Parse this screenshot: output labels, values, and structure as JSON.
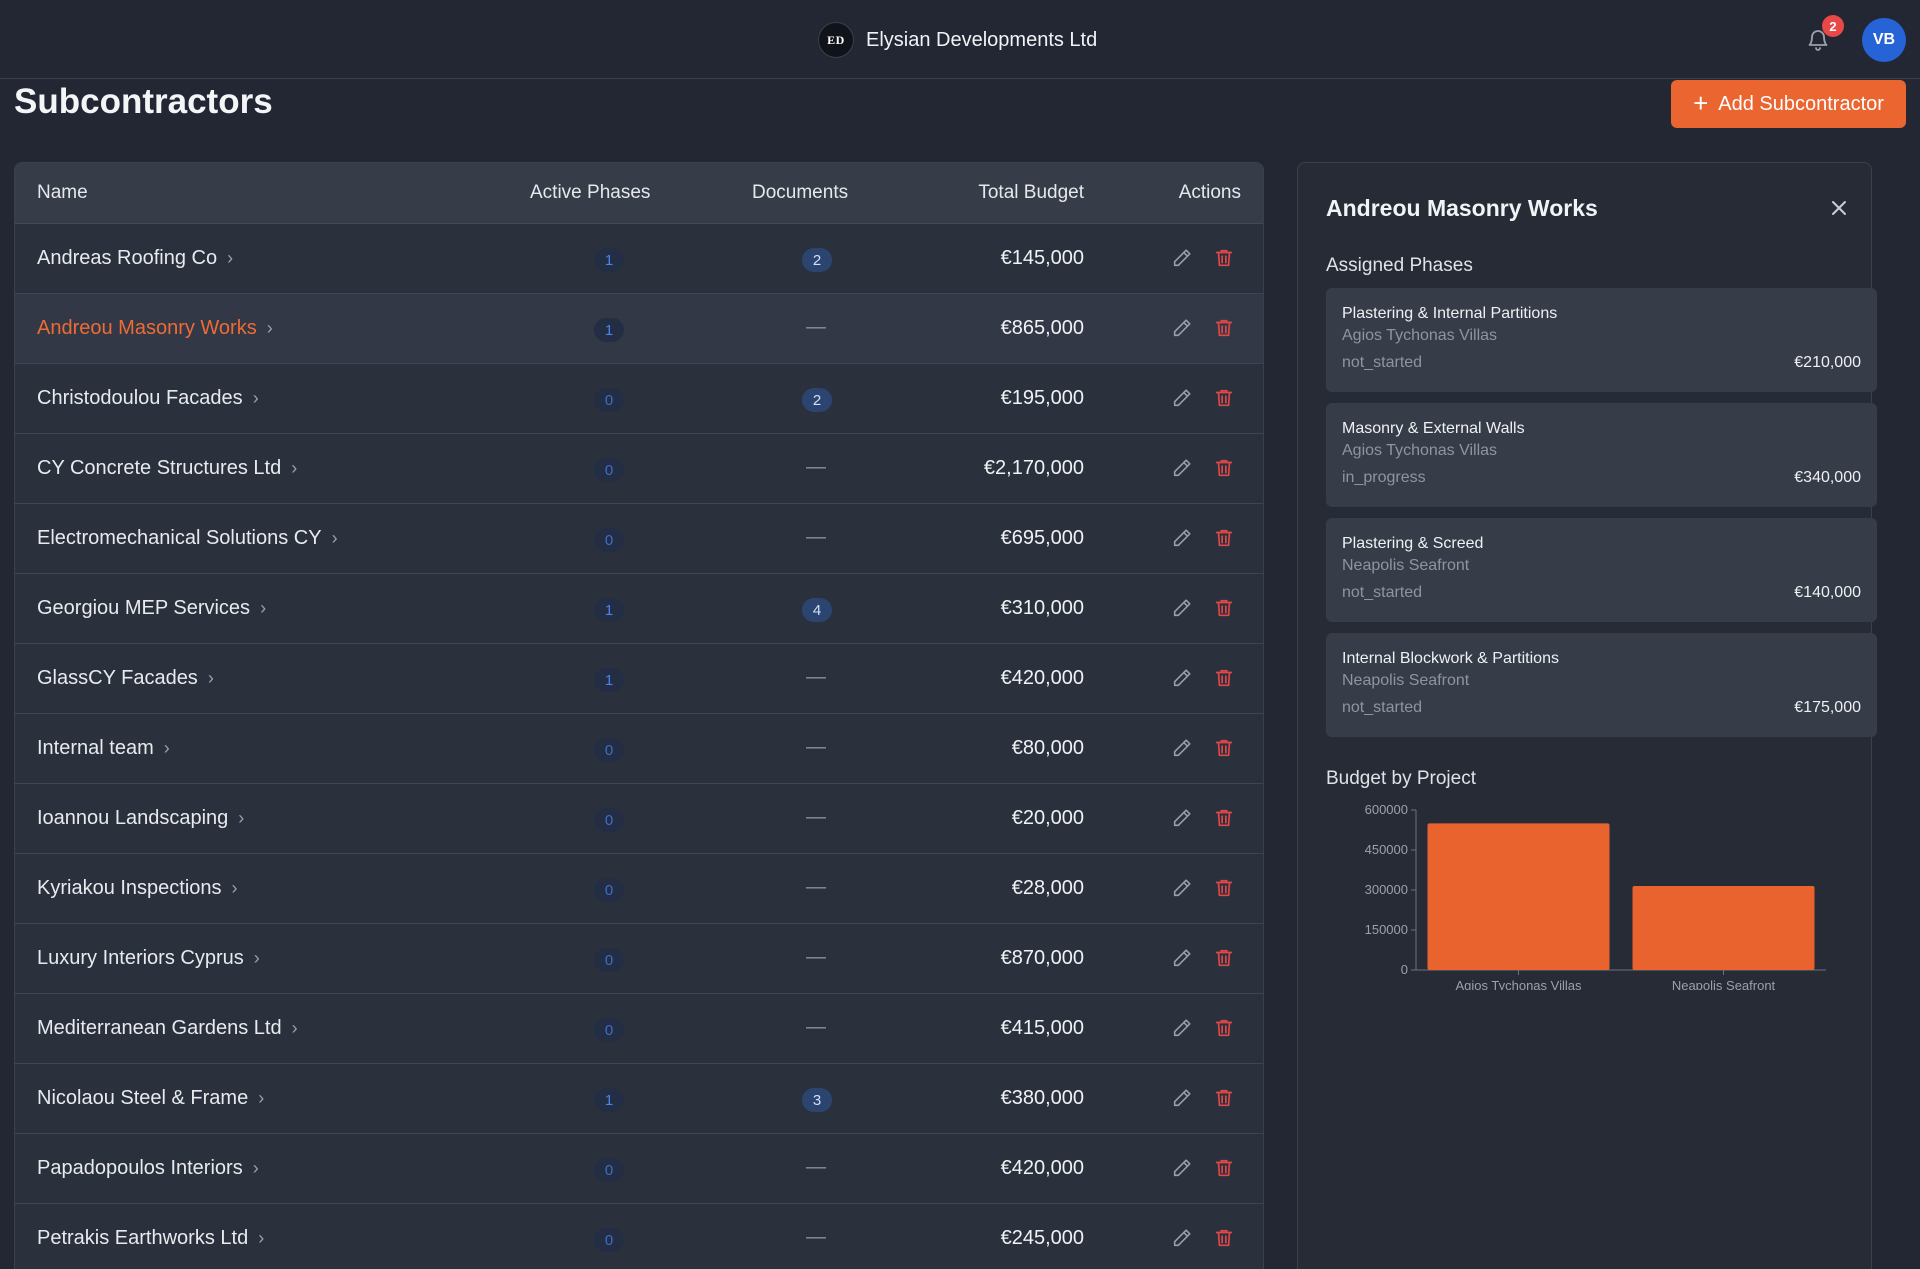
{
  "app": {
    "company_name": "Elysian Developments Ltd",
    "logo_text": "ED",
    "notification_count": "2",
    "user_initials": "VB"
  },
  "page": {
    "title": "Subcontractors",
    "add_button_label": "Add Subcontractor"
  },
  "table": {
    "columns": [
      "Name",
      "Active Phases",
      "Documents",
      "Total Budget",
      "Actions"
    ],
    "rows": [
      {
        "name": "Andreas Roofing Co",
        "active_phases": "1",
        "documents": "2",
        "total_budget": "€145,000",
        "selected": false
      },
      {
        "name": "Andreou Masonry Works",
        "active_phases": "1",
        "documents": "—",
        "total_budget": "€865,000",
        "selected": true
      },
      {
        "name": "Christodoulou Facades",
        "active_phases": "0",
        "documents": "2",
        "total_budget": "€195,000",
        "selected": false
      },
      {
        "name": "CY Concrete Structures Ltd",
        "active_phases": "0",
        "documents": "—",
        "total_budget": "€2,170,000",
        "selected": false
      },
      {
        "name": "Electromechanical Solutions CY",
        "active_phases": "0",
        "documents": "—",
        "total_budget": "€695,000",
        "selected": false
      },
      {
        "name": "Georgiou MEP Services",
        "active_phases": "1",
        "documents": "4",
        "total_budget": "€310,000",
        "selected": false
      },
      {
        "name": "GlassCY Facades",
        "active_phases": "1",
        "documents": "—",
        "total_budget": "€420,000",
        "selected": false
      },
      {
        "name": "Internal team",
        "active_phases": "0",
        "documents": "—",
        "total_budget": "€80,000",
        "selected": false
      },
      {
        "name": "Ioannou Landscaping",
        "active_phases": "0",
        "documents": "—",
        "total_budget": "€20,000",
        "selected": false
      },
      {
        "name": "Kyriakou Inspections",
        "active_phases": "0",
        "documents": "—",
        "total_budget": "€28,000",
        "selected": false
      },
      {
        "name": "Luxury Interiors Cyprus",
        "active_phases": "0",
        "documents": "—",
        "total_budget": "€870,000",
        "selected": false
      },
      {
        "name": "Mediterranean Gardens Ltd",
        "active_phases": "0",
        "documents": "—",
        "total_budget": "€415,000",
        "selected": false
      },
      {
        "name": "Nicolaou Steel & Frame",
        "active_phases": "1",
        "documents": "3",
        "total_budget": "€380,000",
        "selected": false
      },
      {
        "name": "Papadopoulos Interiors",
        "active_phases": "0",
        "documents": "—",
        "total_budget": "€420,000",
        "selected": false
      },
      {
        "name": "Petrakis Earthworks Ltd",
        "active_phases": "0",
        "documents": "—",
        "total_budget": "€245,000",
        "selected": false
      }
    ]
  },
  "detail": {
    "title": "Andreou Masonry Works",
    "assigned_phases_label": "Assigned Phases",
    "phases": [
      {
        "name": "Plastering & Internal Partitions",
        "project": "Agios Tychonas Villas",
        "status": "not_started",
        "budget": "€210,000"
      },
      {
        "name": "Masonry & External Walls",
        "project": "Agios Tychonas Villas",
        "status": "in_progress",
        "budget": "€340,000"
      },
      {
        "name": "Plastering & Screed",
        "project": "Neapolis Seafront",
        "status": "not_started",
        "budget": "€140,000"
      },
      {
        "name": "Internal Blockwork & Partitions",
        "project": "Neapolis Seafront",
        "status": "not_started",
        "budget": "€175,000"
      }
    ],
    "budget_by_project_label": "Budget by Project"
  },
  "chart_data": {
    "type": "bar",
    "title": "",
    "categories": [
      "Agios Tychonas Villas",
      "Neapolis Seafront"
    ],
    "values": [
      550000,
      315000
    ],
    "ylim": [
      0,
      600000
    ],
    "yticks": [
      0,
      150000,
      300000,
      450000,
      600000
    ],
    "bar_color": "#e8632e",
    "grid": false
  },
  "colors": {
    "accent": "#ea6530",
    "delete": "#e04848",
    "link_selected": "#ef6b35",
    "avatar": "#2563d6"
  }
}
